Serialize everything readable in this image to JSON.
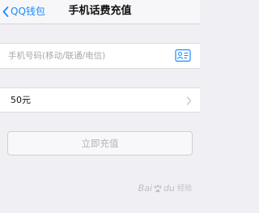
{
  "navbar": {
    "back_label": "QQ钱包",
    "title": "手机话费充值"
  },
  "form": {
    "phone_placeholder": "手机号码(移动/联通/电信)",
    "phone_value": "",
    "amount_value": "50元",
    "submit_label": "立即充值"
  },
  "watermark": {
    "brand": "Bai",
    "paw": "du",
    "suffix": "经验"
  },
  "icons": {
    "back": "chevron-left-icon",
    "contacts": "contact-card-icon",
    "amount_more": "chevron-right-icon"
  },
  "colors": {
    "accent": "#1a8cff",
    "background": "#efeff4"
  }
}
